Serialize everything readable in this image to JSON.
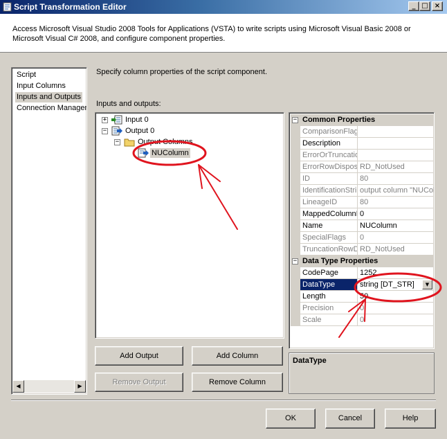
{
  "window": {
    "title": "Script Transformation Editor",
    "controls": {
      "minimize": "_",
      "maximize": "□",
      "close": "×"
    }
  },
  "header": {
    "description": "Access Microsoft Visual Studio 2008 Tools for Applications (VSTA) to write scripts using Microsoft Visual Basic 2008 or Microsoft Visual C# 2008, and configure component properties."
  },
  "nav": {
    "items": [
      {
        "label": "Script"
      },
      {
        "label": "Input Columns"
      },
      {
        "label": "Inputs and Outputs",
        "selected": true
      },
      {
        "label": "Connection Managers"
      }
    ]
  },
  "main": {
    "description": "Specify column properties of the script component.",
    "io_label": "Inputs and outputs:"
  },
  "tree": {
    "input0": "Input 0",
    "output0": "Output 0",
    "output_columns": "Output Columns",
    "nucolumn": "NUColumn"
  },
  "properties": {
    "common_title": "Common Properties",
    "common": [
      {
        "name": "ComparisonFlags",
        "value": "",
        "readonly": true
      },
      {
        "name": "Description",
        "value": "",
        "readonly": false
      },
      {
        "name": "ErrorOrTruncationOperation",
        "value": "",
        "readonly": true
      },
      {
        "name": "ErrorRowDisposition",
        "value": "RD_NotUsed",
        "readonly": true
      },
      {
        "name": "ID",
        "value": "80",
        "readonly": true
      },
      {
        "name": "IdentificationString",
        "value": "output column \"NUColumn\"",
        "readonly": true
      },
      {
        "name": "LineageID",
        "value": "80",
        "readonly": true
      },
      {
        "name": "MappedColumnID",
        "value": "0",
        "readonly": false
      },
      {
        "name": "Name",
        "value": "NUColumn",
        "readonly": false
      },
      {
        "name": "SpecialFlags",
        "value": "0",
        "readonly": true
      },
      {
        "name": "TruncationRowDisposition",
        "value": "RD_NotUsed",
        "readonly": true
      }
    ],
    "datatype_title": "Data Type Properties",
    "datatype": [
      {
        "name": "CodePage",
        "value": "1252",
        "readonly": false
      },
      {
        "name": "DataType",
        "value": "string [DT_STR]",
        "readonly": false,
        "selected": true
      },
      {
        "name": "Length",
        "value": "50",
        "readonly": false
      },
      {
        "name": "Precision",
        "value": "0",
        "readonly": true
      },
      {
        "name": "Scale",
        "value": "0",
        "readonly": true
      }
    ]
  },
  "help": {
    "title": "DataType"
  },
  "buttons": {
    "add_output": "Add Output",
    "add_column": "Add Column",
    "remove_output": "Remove Output",
    "remove_column": "Remove Column",
    "ok": "OK",
    "cancel": "Cancel",
    "help": "Help"
  },
  "annotation_color": "#e0141e"
}
